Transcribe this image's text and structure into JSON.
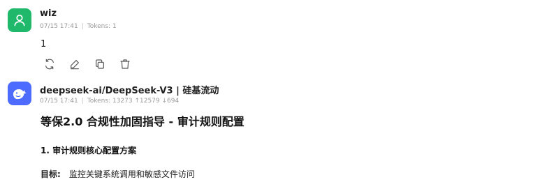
{
  "user_message": {
    "name": "wiz",
    "timestamp": "07/15 17:41",
    "meta_sep": "|",
    "tokens": "Tokens: 1",
    "text": "1",
    "actions": [
      {
        "name": "regenerate",
        "icon": "refresh-icon"
      },
      {
        "name": "edit",
        "icon": "pencil-icon"
      },
      {
        "name": "copy",
        "icon": "copy-icon"
      },
      {
        "name": "delete",
        "icon": "trash-icon"
      }
    ]
  },
  "ai_message": {
    "name": "deepseek-ai/DeepSeek-V3 | 硅基流动",
    "timestamp": "07/15 17:41",
    "meta_sep": "|",
    "tokens": "Tokens: 13273 ↑12579 ↓694",
    "heading": "等保2.0 合规性加固指导 - 审计规则配置",
    "subheading": "1. 审计规则核心配置方案",
    "goal_label": "目标:",
    "goal_text": "监控关键系统调用和敏感文件访问"
  },
  "colors": {
    "user_avatar": "#20b86b",
    "ai_avatar": "#4d6bfe",
    "meta_text": "#9a9a9a"
  }
}
